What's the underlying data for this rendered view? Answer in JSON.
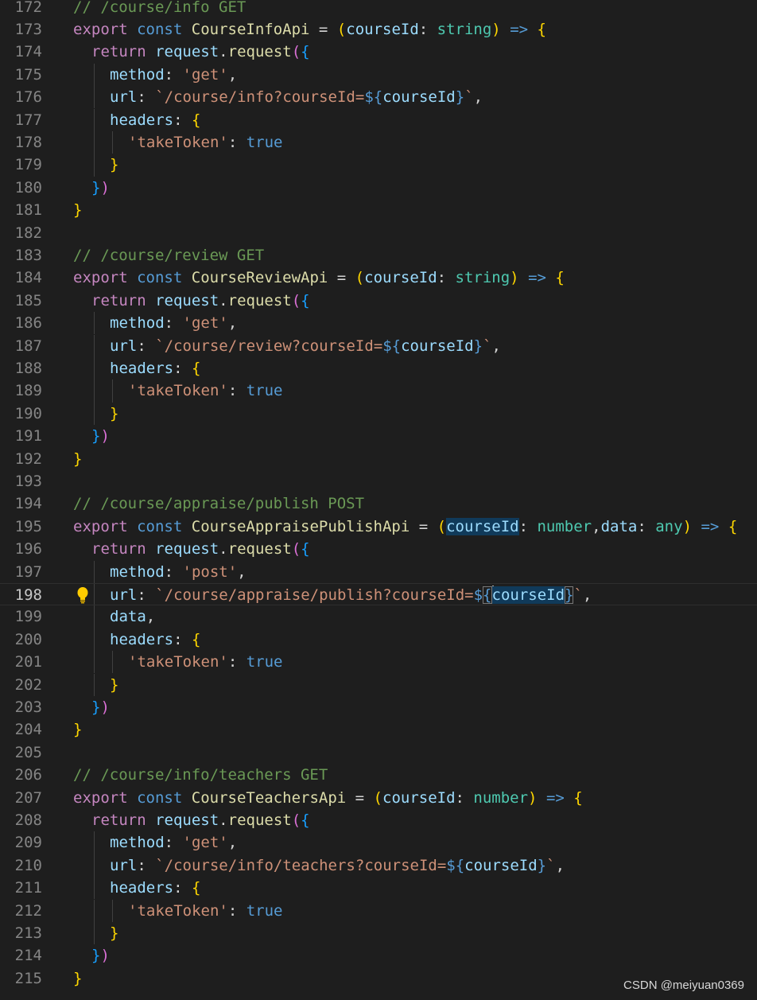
{
  "editor": {
    "current_line": 198,
    "lines": [
      {
        "n": 172,
        "indent": 0,
        "tokens": [
          [
            "// /course/info GET",
            "cm"
          ]
        ]
      },
      {
        "n": 173,
        "indent": 0,
        "tokens": [
          [
            "export",
            "ctl"
          ],
          [
            " ",
            "op"
          ],
          [
            "const",
            "kw"
          ],
          [
            " ",
            "op"
          ],
          [
            "CourseInfoApi",
            "fn"
          ],
          [
            " = ",
            "op"
          ],
          [
            "(",
            "b1"
          ],
          [
            "courseId",
            "vr"
          ],
          [
            ": ",
            "op"
          ],
          [
            "string",
            "ty"
          ],
          [
            ")",
            "b1"
          ],
          [
            " ",
            "op"
          ],
          [
            "=>",
            "kw"
          ],
          [
            " ",
            "op"
          ],
          [
            "{",
            "b1"
          ]
        ]
      },
      {
        "n": 174,
        "indent": 1,
        "tokens": [
          [
            "return",
            "ctl"
          ],
          [
            " ",
            "op"
          ],
          [
            "request",
            "vr"
          ],
          [
            ".",
            "op"
          ],
          [
            "request",
            "fn"
          ],
          [
            "(",
            "b2"
          ],
          [
            "{",
            "b3"
          ]
        ]
      },
      {
        "n": 175,
        "indent": 2,
        "tokens": [
          [
            "method",
            "vr"
          ],
          [
            ": ",
            "op"
          ],
          [
            "'get'",
            "st"
          ],
          [
            ",",
            "op"
          ]
        ]
      },
      {
        "n": 176,
        "indent": 2,
        "tokens": [
          [
            "url",
            "vr"
          ],
          [
            ": ",
            "op"
          ],
          [
            "`/course/info?courseId=",
            "st"
          ],
          [
            "${",
            "tb"
          ],
          [
            "courseId",
            "vr"
          ],
          [
            "}",
            "tb"
          ],
          [
            "`",
            "st"
          ],
          [
            ",",
            "op"
          ]
        ]
      },
      {
        "n": 177,
        "indent": 2,
        "tokens": [
          [
            "headers",
            "vr"
          ],
          [
            ": ",
            "op"
          ],
          [
            "{",
            "b1"
          ]
        ]
      },
      {
        "n": 178,
        "indent": 3,
        "tokens": [
          [
            "'takeToken'",
            "st"
          ],
          [
            ": ",
            "op"
          ],
          [
            "true",
            "kw"
          ]
        ]
      },
      {
        "n": 179,
        "indent": 2,
        "tokens": [
          [
            "}",
            "b1"
          ]
        ]
      },
      {
        "n": 180,
        "indent": 1,
        "tokens": [
          [
            "}",
            "b3"
          ],
          [
            ")",
            "b2"
          ]
        ]
      },
      {
        "n": 181,
        "indent": 0,
        "tokens": [
          [
            "}",
            "b1"
          ]
        ]
      },
      {
        "n": 182,
        "indent": 0,
        "tokens": []
      },
      {
        "n": 183,
        "indent": 0,
        "tokens": [
          [
            "// /course/review GET",
            "cm"
          ]
        ]
      },
      {
        "n": 184,
        "indent": 0,
        "tokens": [
          [
            "export",
            "ctl"
          ],
          [
            " ",
            "op"
          ],
          [
            "const",
            "kw"
          ],
          [
            " ",
            "op"
          ],
          [
            "CourseReviewApi",
            "fn"
          ],
          [
            " = ",
            "op"
          ],
          [
            "(",
            "b1"
          ],
          [
            "courseId",
            "vr"
          ],
          [
            ": ",
            "op"
          ],
          [
            "string",
            "ty"
          ],
          [
            ")",
            "b1"
          ],
          [
            " ",
            "op"
          ],
          [
            "=>",
            "kw"
          ],
          [
            " ",
            "op"
          ],
          [
            "{",
            "b1"
          ]
        ]
      },
      {
        "n": 185,
        "indent": 1,
        "tokens": [
          [
            "return",
            "ctl"
          ],
          [
            " ",
            "op"
          ],
          [
            "request",
            "vr"
          ],
          [
            ".",
            "op"
          ],
          [
            "request",
            "fn"
          ],
          [
            "(",
            "b2"
          ],
          [
            "{",
            "b3"
          ]
        ]
      },
      {
        "n": 186,
        "indent": 2,
        "tokens": [
          [
            "method",
            "vr"
          ],
          [
            ": ",
            "op"
          ],
          [
            "'get'",
            "st"
          ],
          [
            ",",
            "op"
          ]
        ]
      },
      {
        "n": 187,
        "indent": 2,
        "tokens": [
          [
            "url",
            "vr"
          ],
          [
            ": ",
            "op"
          ],
          [
            "`/course/review?courseId=",
            "st"
          ],
          [
            "${",
            "tb"
          ],
          [
            "courseId",
            "vr"
          ],
          [
            "}",
            "tb"
          ],
          [
            "`",
            "st"
          ],
          [
            ",",
            "op"
          ]
        ]
      },
      {
        "n": 188,
        "indent": 2,
        "tokens": [
          [
            "headers",
            "vr"
          ],
          [
            ": ",
            "op"
          ],
          [
            "{",
            "b1"
          ]
        ]
      },
      {
        "n": 189,
        "indent": 3,
        "tokens": [
          [
            "'takeToken'",
            "st"
          ],
          [
            ": ",
            "op"
          ],
          [
            "true",
            "kw"
          ]
        ]
      },
      {
        "n": 190,
        "indent": 2,
        "tokens": [
          [
            "}",
            "b1"
          ]
        ]
      },
      {
        "n": 191,
        "indent": 1,
        "tokens": [
          [
            "}",
            "b3"
          ],
          [
            ")",
            "b2"
          ]
        ]
      },
      {
        "n": 192,
        "indent": 0,
        "tokens": [
          [
            "}",
            "b1"
          ]
        ]
      },
      {
        "n": 193,
        "indent": 0,
        "tokens": []
      },
      {
        "n": 194,
        "indent": 0,
        "tokens": [
          [
            "// /course/appraise/publish POST",
            "cm"
          ]
        ]
      },
      {
        "n": 195,
        "indent": 0,
        "tokens": [
          [
            "export",
            "ctl"
          ],
          [
            " ",
            "op"
          ],
          [
            "const",
            "kw"
          ],
          [
            " ",
            "op"
          ],
          [
            "CourseAppraisePublishApi",
            "fn"
          ],
          [
            " = ",
            "op"
          ],
          [
            "(",
            "b1"
          ],
          [
            "courseId",
            "vr",
            "hl-word"
          ],
          [
            ": ",
            "op"
          ],
          [
            "number",
            "ty"
          ],
          [
            ",",
            "op"
          ],
          [
            "data",
            "vr"
          ],
          [
            ": ",
            "op"
          ],
          [
            "any",
            "ty"
          ],
          [
            ")",
            "b1"
          ],
          [
            " ",
            "op"
          ],
          [
            "=>",
            "kw"
          ],
          [
            " ",
            "op"
          ],
          [
            "{",
            "b1"
          ]
        ]
      },
      {
        "n": 196,
        "indent": 1,
        "tokens": [
          [
            "return",
            "ctl"
          ],
          [
            " ",
            "op"
          ],
          [
            "request",
            "vr"
          ],
          [
            ".",
            "op"
          ],
          [
            "request",
            "fn"
          ],
          [
            "(",
            "b2"
          ],
          [
            "{",
            "b3"
          ]
        ]
      },
      {
        "n": 197,
        "indent": 2,
        "tokens": [
          [
            "method",
            "vr"
          ],
          [
            ": ",
            "op"
          ],
          [
            "'post'",
            "st"
          ],
          [
            ",",
            "op"
          ]
        ]
      },
      {
        "n": 198,
        "indent": 2,
        "tokens": [
          [
            "url",
            "vr"
          ],
          [
            ": ",
            "op"
          ],
          [
            "`/course/appraise/publish?courseId=",
            "st"
          ],
          [
            "$",
            "tb"
          ],
          [
            "{",
            "tb",
            "hl-brk"
          ],
          [
            "|",
            "cursor"
          ],
          [
            "courseId",
            "vr",
            "hl-word"
          ],
          [
            "}",
            "tb",
            "hl-brk"
          ],
          [
            "`",
            "st"
          ],
          [
            ",",
            "op"
          ]
        ]
      },
      {
        "n": 199,
        "indent": 2,
        "tokens": [
          [
            "data",
            "vr"
          ],
          [
            ",",
            "op"
          ]
        ]
      },
      {
        "n": 200,
        "indent": 2,
        "tokens": [
          [
            "headers",
            "vr"
          ],
          [
            ": ",
            "op"
          ],
          [
            "{",
            "b1"
          ]
        ]
      },
      {
        "n": 201,
        "indent": 3,
        "tokens": [
          [
            "'takeToken'",
            "st"
          ],
          [
            ": ",
            "op"
          ],
          [
            "true",
            "kw"
          ]
        ]
      },
      {
        "n": 202,
        "indent": 2,
        "tokens": [
          [
            "}",
            "b1"
          ]
        ]
      },
      {
        "n": 203,
        "indent": 1,
        "tokens": [
          [
            "}",
            "b3"
          ],
          [
            ")",
            "b2"
          ]
        ]
      },
      {
        "n": 204,
        "indent": 0,
        "tokens": [
          [
            "}",
            "b1"
          ]
        ]
      },
      {
        "n": 205,
        "indent": 0,
        "tokens": []
      },
      {
        "n": 206,
        "indent": 0,
        "tokens": [
          [
            "// /course/info/teachers GET",
            "cm"
          ]
        ]
      },
      {
        "n": 207,
        "indent": 0,
        "tokens": [
          [
            "export",
            "ctl"
          ],
          [
            " ",
            "op"
          ],
          [
            "const",
            "kw"
          ],
          [
            " ",
            "op"
          ],
          [
            "CourseTeachersApi",
            "fn"
          ],
          [
            " = ",
            "op"
          ],
          [
            "(",
            "b1"
          ],
          [
            "courseId",
            "vr"
          ],
          [
            ": ",
            "op"
          ],
          [
            "number",
            "ty"
          ],
          [
            ")",
            "b1"
          ],
          [
            " ",
            "op"
          ],
          [
            "=>",
            "kw"
          ],
          [
            " ",
            "op"
          ],
          [
            "{",
            "b1"
          ]
        ]
      },
      {
        "n": 208,
        "indent": 1,
        "tokens": [
          [
            "return",
            "ctl"
          ],
          [
            " ",
            "op"
          ],
          [
            "request",
            "vr"
          ],
          [
            ".",
            "op"
          ],
          [
            "request",
            "fn"
          ],
          [
            "(",
            "b2"
          ],
          [
            "{",
            "b3"
          ]
        ]
      },
      {
        "n": 209,
        "indent": 2,
        "tokens": [
          [
            "method",
            "vr"
          ],
          [
            ": ",
            "op"
          ],
          [
            "'get'",
            "st"
          ],
          [
            ",",
            "op"
          ]
        ]
      },
      {
        "n": 210,
        "indent": 2,
        "tokens": [
          [
            "url",
            "vr"
          ],
          [
            ": ",
            "op"
          ],
          [
            "`/course/info/teachers?courseId=",
            "st"
          ],
          [
            "${",
            "tb"
          ],
          [
            "courseId",
            "vr"
          ],
          [
            "}",
            "tb"
          ],
          [
            "`",
            "st"
          ],
          [
            ",",
            "op"
          ]
        ]
      },
      {
        "n": 211,
        "indent": 2,
        "tokens": [
          [
            "headers",
            "vr"
          ],
          [
            ": ",
            "op"
          ],
          [
            "{",
            "b1"
          ]
        ]
      },
      {
        "n": 212,
        "indent": 3,
        "tokens": [
          [
            "'takeToken'",
            "st"
          ],
          [
            ": ",
            "op"
          ],
          [
            "true",
            "kw"
          ]
        ]
      },
      {
        "n": 213,
        "indent": 2,
        "tokens": [
          [
            "}",
            "b1"
          ]
        ]
      },
      {
        "n": 214,
        "indent": 1,
        "tokens": [
          [
            "}",
            "b3"
          ],
          [
            ")",
            "b2"
          ]
        ]
      },
      {
        "n": 215,
        "indent": 0,
        "tokens": [
          [
            "}",
            "b1"
          ]
        ]
      }
    ]
  },
  "lightbulb": {
    "icon": "lightbulb-icon",
    "line": 198,
    "color": "#ffcc00"
  },
  "watermark": {
    "text": "CSDN @meiyuan0369"
  }
}
